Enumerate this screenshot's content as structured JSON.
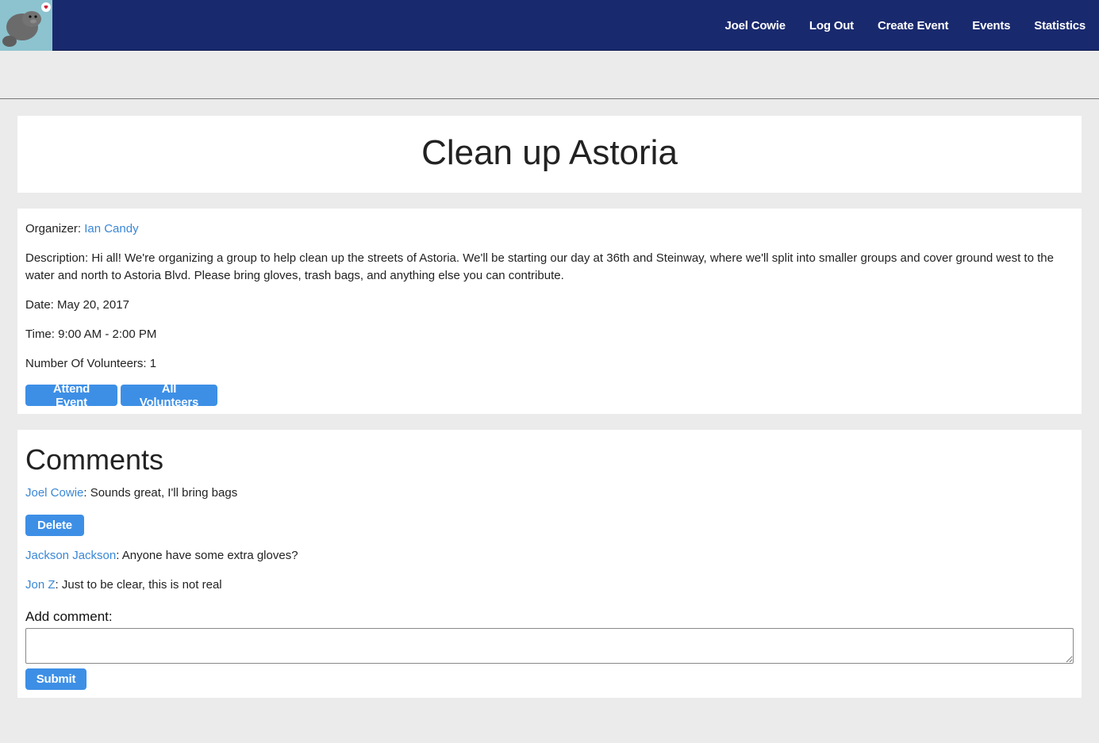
{
  "nav": {
    "user": "Joel Cowie",
    "logout": "Log Out",
    "create_event": "Create Event",
    "events": "Events",
    "statistics": "Statistics"
  },
  "event": {
    "title": "Clean up Astoria",
    "organizer_label": "Organizer: ",
    "organizer_name": "Ian Candy",
    "description_label": "Description: ",
    "description": "Hi all! We're organizing a group to help clean up the streets of Astoria. We'll be starting our day at 36th and Steinway, where we'll split into smaller groups and cover ground west to the water and north to Astoria Blvd. Please bring gloves, trash bags, and anything else you can contribute.",
    "date": "Date: May 20, 2017",
    "time": "Time: 9:00 AM - 2:00 PM",
    "volunteers": "Number Of Volunteers: 1",
    "attend_button": "Attend Event",
    "all_volunteers_button": "All Volunteers"
  },
  "comments": {
    "heading": "Comments",
    "items": [
      {
        "author": "Joel Cowie",
        "text": ": Sounds great, I'll bring bags",
        "delete": "Delete"
      },
      {
        "author": "Jackson Jackson",
        "text": ": Anyone have some extra gloves?"
      },
      {
        "author": "Jon Z",
        "text": ": Just to be clear, this is not real"
      }
    ],
    "add_label": "Add comment:",
    "input_value": "",
    "submit": "Submit"
  },
  "colors": {
    "navbar": "#19296e",
    "accent_button": "#3d8fe6",
    "link": "#3a87d6",
    "background": "#ebebeb"
  },
  "icons": {
    "logo": "manatee-heart-logo"
  }
}
